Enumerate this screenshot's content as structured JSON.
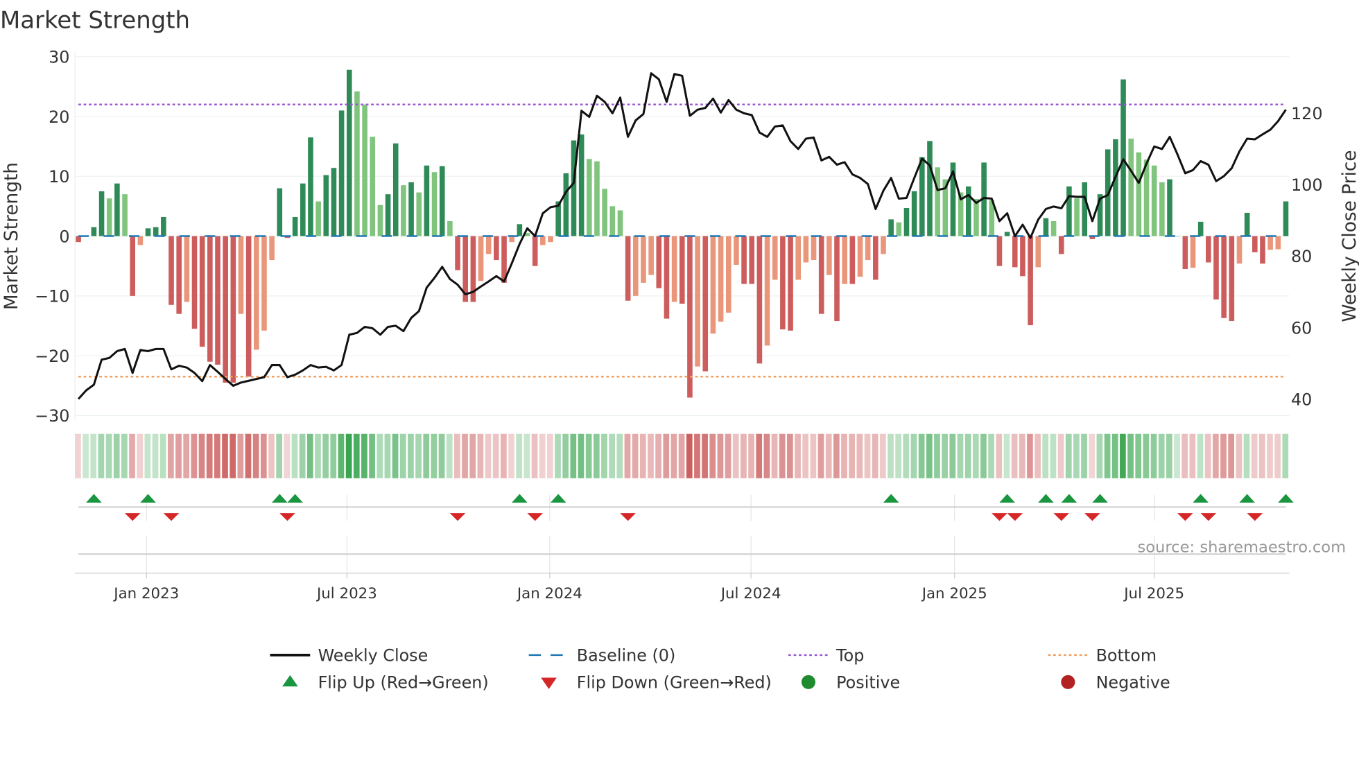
{
  "chart_data": {
    "type": "bar",
    "title": "Market Strength",
    "ylabel": "Market Strength",
    "y2label": "Weekly Close Price",
    "ylim": [
      -30,
      30
    ],
    "y2lim": [
      36,
      138
    ],
    "yticks": [
      30,
      20,
      10,
      0,
      -10,
      -20,
      -30
    ],
    "y2ticks": [
      120,
      100,
      80,
      60,
      40
    ],
    "xticks": [
      "Jan 2023",
      "Jul 2023",
      "Jan 2024",
      "Jul 2024",
      "Jan 2025",
      "Jul 2025"
    ],
    "xtick_week_index": [
      8.8,
      34.7,
      60.9,
      86.9,
      113.2,
      139
    ],
    "top_level": 22,
    "bottom_level": -23.5,
    "frequency": "weekly",
    "strength": [
      -1,
      0,
      1.5,
      7.5,
      6.3,
      8.8,
      7,
      -10,
      -1.5,
      1.3,
      1.5,
      3.2,
      -11.5,
      -13,
      -11,
      -15.5,
      -18.5,
      -21,
      -21.5,
      -24.5,
      -24.5,
      -13,
      -23.5,
      -19,
      -15.8,
      -4,
      8,
      -0.3,
      3.2,
      8.8,
      16.5,
      5.8,
      10.2,
      11.4,
      21,
      27.8,
      24.2,
      22,
      16.6,
      5.2,
      7,
      15.5,
      8.5,
      9,
      7.3,
      11.8,
      10.7,
      11.7,
      2.5,
      -5.7,
      -11,
      -11,
      -7.5,
      -3,
      -4,
      -7.8,
      -1,
      2,
      0.5,
      -5,
      -1.5,
      -1,
      5.8,
      10.5,
      16,
      17,
      12.9,
      12.5,
      7.9,
      5,
      4.3,
      -10.8,
      -10,
      -7.8,
      -6.5,
      -8.7,
      -13.8,
      -11,
      -11.3,
      -27,
      -21.8,
      -22.6,
      -16.3,
      -14.3,
      -12.8,
      -4.8,
      -8,
      -8,
      -21.3,
      -18.3,
      -7.3,
      -15.6,
      -15.8,
      -7.3,
      -4.4,
      -4,
      -13,
      -6.5,
      -14.2,
      -8,
      -8,
      -6.8,
      -4,
      -7.3,
      -3,
      2.8,
      2.3,
      4.7,
      7.5,
      13.2,
      15.9,
      11.5,
      9.5,
      12.3,
      7.3,
      8.3,
      6.2,
      12.3,
      6,
      -5,
      0.7,
      -5.2,
      -6.7,
      -14.9,
      -5.2,
      3,
      2.5,
      -3,
      8.3,
      6.3,
      9,
      -0.5,
      7,
      14.5,
      16.2,
      26.2,
      16.3,
      14,
      12.8,
      11.8,
      9,
      9.5,
      0,
      -5.5,
      -5.3,
      2.4,
      -4.4,
      -10.6,
      -13.7,
      -14.2,
      -4.6,
      3.9,
      -2.7,
      -4.6,
      -2.3,
      -2.2,
      5.8
    ],
    "weekly_close": [
      40,
      42.4,
      44,
      51,
      51.5,
      53.4,
      54,
      47.3,
      53.7,
      53.4,
      54,
      54,
      48.3,
      49.3,
      48.8,
      47.3,
      45,
      49.5,
      47.6,
      45.6,
      43.7,
      44.6,
      45.1,
      45.6,
      46.1,
      49.5,
      49.5,
      46.1,
      46.8,
      48,
      49.5,
      48.8,
      49,
      48,
      49.5,
      58,
      58.5,
      60.2,
      59.8,
      58,
      60.2,
      60.5,
      59,
      62.7,
      64.6,
      71.2,
      73.9,
      77,
      73.6,
      72,
      69.3,
      70,
      71.5,
      72.9,
      74.4,
      72.9,
      78,
      83.4,
      87.8,
      85.6,
      92,
      93.7,
      94.1,
      98,
      100.5,
      120.7,
      119,
      124.9,
      123.2,
      120,
      124.4,
      113.4,
      118,
      119.8,
      131.2,
      129.5,
      123.2,
      131,
      130.5,
      119.3,
      121,
      121.5,
      124.1,
      120.2,
      123.7,
      121,
      120,
      119.5,
      114.6,
      113.4,
      116.3,
      116.6,
      112.2,
      110,
      112.9,
      113.2,
      106.8,
      107.8,
      105.6,
      106.3,
      102.9,
      101.9,
      100.2,
      93.2,
      98.3,
      101.9,
      96.1,
      96.3,
      101.9,
      107.3,
      105.4,
      98.5,
      99,
      103.7,
      95.9,
      97.1,
      94.9,
      96.3,
      96.1,
      89.8,
      92,
      85.6,
      88.8,
      85.1,
      90.2,
      93.2,
      93.9,
      93.4,
      96.8,
      96.6,
      96.6,
      89.8,
      96.1,
      97.1,
      102.2,
      107.1,
      103.9,
      100.5,
      105.9,
      110.7,
      110,
      113.4,
      108.5,
      103.2,
      104.1,
      106.6,
      105.6,
      101,
      102.4,
      104.6,
      109.3,
      112.9,
      112.7,
      114.1,
      115.4,
      117.8,
      121
    ],
    "flip_up_week_index": [
      2,
      9,
      26,
      28,
      57,
      62,
      105,
      120,
      125,
      128,
      132,
      145,
      151,
      156
    ],
    "flip_down_week_index": [
      7,
      12,
      27,
      49,
      59,
      71,
      119,
      121,
      127,
      131,
      143,
      146,
      152
    ],
    "legend": {
      "placement": "bottom",
      "entries": [
        {
          "label": "Weekly Close",
          "kind": "solid-line",
          "color": "#111111"
        },
        {
          "label": "Baseline (0)",
          "kind": "dashed-line",
          "color": "#1f77b4"
        },
        {
          "label": "Top",
          "kind": "dotted-line",
          "color": "#9b59d0"
        },
        {
          "label": "Bottom",
          "kind": "dotted-line",
          "color": "#f0a060"
        },
        {
          "label": "Flip Up (Red→Green)",
          "kind": "triangle-up",
          "color": "#1a9641"
        },
        {
          "label": "Flip Down (Green→Red)",
          "kind": "triangle-down",
          "color": "#d62728"
        },
        {
          "label": "Positive",
          "kind": "circle",
          "color": "#1e8c2e"
        },
        {
          "label": "Negative",
          "kind": "circle",
          "color": "#b22222"
        }
      ]
    },
    "colors": {
      "green_dark": "#2e8b57",
      "green_light": "#80c47e",
      "red_dark": "#cd5c5c",
      "red_light": "#e9967a",
      "top": "#9b59d0",
      "bottom": "#f0a060",
      "baseline": "#1f77b4"
    }
  },
  "source": "source: sharemaestro.com"
}
